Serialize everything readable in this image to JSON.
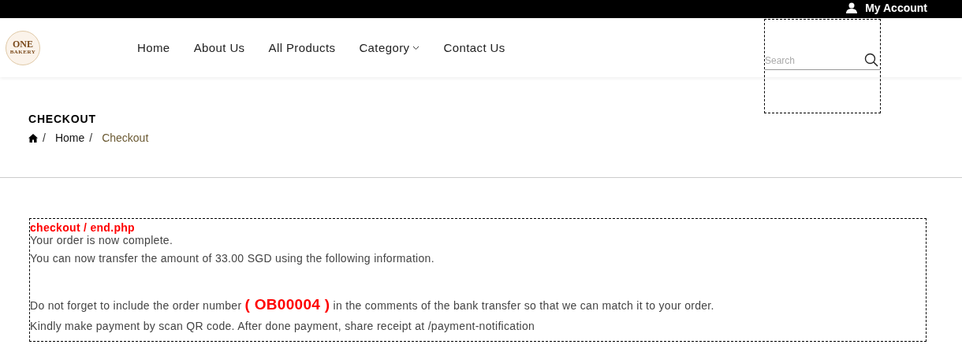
{
  "top_bar": {
    "account_link": "My Account"
  },
  "header": {
    "logo": {
      "title": "ONE",
      "subtitle": "BAKERY"
    },
    "nav": [
      {
        "label": "Home",
        "kind": "link"
      },
      {
        "label": "About Us",
        "kind": "link"
      },
      {
        "label": "All Products",
        "kind": "link"
      },
      {
        "label": "Category",
        "kind": "dropdown"
      },
      {
        "label": "Contact Us",
        "kind": "link"
      }
    ],
    "search": {
      "placeholder": "Search"
    }
  },
  "page_title": "CHECKOUT",
  "breadcrumb": [
    {
      "separator": "/",
      "label": "Home",
      "selected": false
    },
    {
      "separator": "/",
      "label": "Checkout",
      "selected": true
    }
  ],
  "message": {
    "file_label": "checkout / end.php",
    "lines": [
      "Your order is now complete.",
      "You can now transfer the amount of 33.00 SGD using the following information."
    ],
    "notes": [
      "Do not forget to include the order number **( OB00004 )** in the comments of the bank transfer so that we can match it to your order.",
      "Kindly make payment by scan QR code. After done payment, share receipt at /payment-notification"
    ]
  }
}
